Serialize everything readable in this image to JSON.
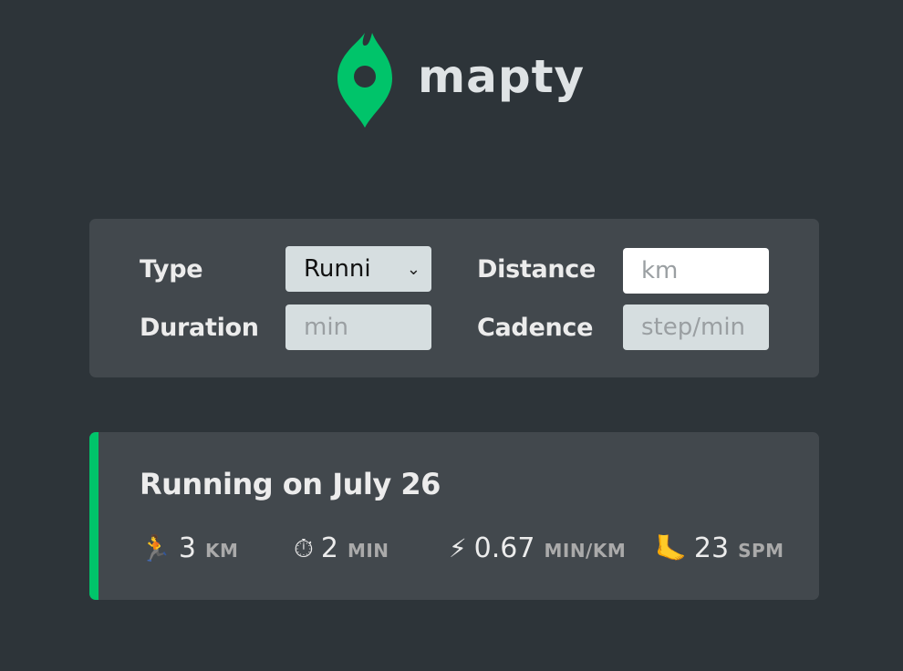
{
  "brand": {
    "name": "mapty",
    "accent": "#00c46a"
  },
  "form": {
    "type_label": "Type",
    "type_value": "Runni",
    "distance_label": "Distance",
    "distance_placeholder": "km",
    "duration_label": "Duration",
    "duration_placeholder": "min",
    "cadence_label": "Cadence",
    "cadence_placeholder": "step/min"
  },
  "workout": {
    "title": "Running on July 26",
    "details": [
      {
        "icon": "🏃",
        "icon_name": "runner-icon",
        "value": "3",
        "unit": "KM"
      },
      {
        "icon": "⏱",
        "icon_name": "stopwatch-icon",
        "value": "2",
        "unit": "MIN"
      },
      {
        "icon": "⚡",
        "icon_name": "lightning-icon",
        "value": "0.67",
        "unit": "MIN/KM"
      },
      {
        "icon": "🦶",
        "icon_name": "foot-icon",
        "value": "23",
        "unit": "SPM"
      }
    ]
  }
}
